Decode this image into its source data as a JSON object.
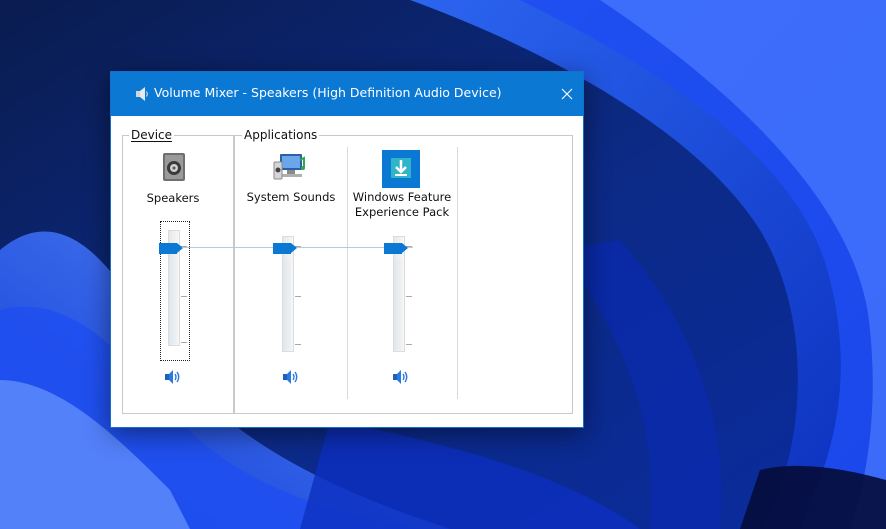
{
  "window": {
    "title": "Volume Mixer - Speakers (High Definition Audio Device)"
  },
  "device_group": {
    "label": "Device"
  },
  "applications_group": {
    "label": "Applications"
  },
  "channels": [
    {
      "name_lines": [
        "Speakers"
      ],
      "icon": "speaker-device-icon",
      "volume": 0.85
    },
    {
      "name_lines": [
        "System Sounds"
      ],
      "icon": "system-sounds-icon",
      "volume": 0.85
    },
    {
      "name_lines": [
        "Windows Feature",
        "Experience Pack"
      ],
      "icon": "download-app-icon",
      "volume": 0.85
    }
  ],
  "colors": {
    "accent": "#0b78d4",
    "titlebar": "#0b78d4"
  }
}
